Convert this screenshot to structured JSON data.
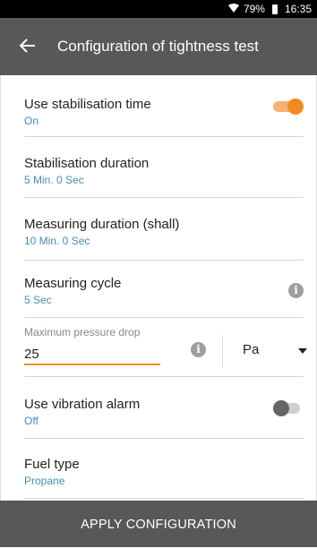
{
  "status_bar": {
    "battery": "79%",
    "time": "16:35",
    "wifi_icon": "wifi-icon",
    "battery_icon": "battery-icon"
  },
  "app_bar": {
    "title": "Configuration of tightness test",
    "back_icon": "arrow-left-icon"
  },
  "settings": {
    "stabilisation_time": {
      "label": "Use stabilisation time",
      "value": "On",
      "enabled": true
    },
    "stabilisation_duration": {
      "label": "Stabilisation duration",
      "value": "5 Min. 0 Sec"
    },
    "measuring_duration": {
      "label": "Measuring duration (shall)",
      "value": "10 Min. 0 Sec"
    },
    "measuring_cycle": {
      "label": "Measuring cycle",
      "value": "5 Sec",
      "info_icon": "info-icon"
    },
    "max_pressure_drop": {
      "label": "Maximum pressure drop",
      "value": "25",
      "unit": "Pa",
      "info_icon": "info-icon"
    },
    "vibration_alarm": {
      "label": "Use vibration alarm",
      "value": "Off",
      "enabled": false
    },
    "fuel_type": {
      "label": "Fuel type",
      "value": "Propane"
    }
  },
  "apply_button": {
    "label": "APPLY CONFIGURATION"
  },
  "colors": {
    "app_bar": "#585858",
    "accent": "#f08a24",
    "value_text": "#4a8bb0"
  }
}
